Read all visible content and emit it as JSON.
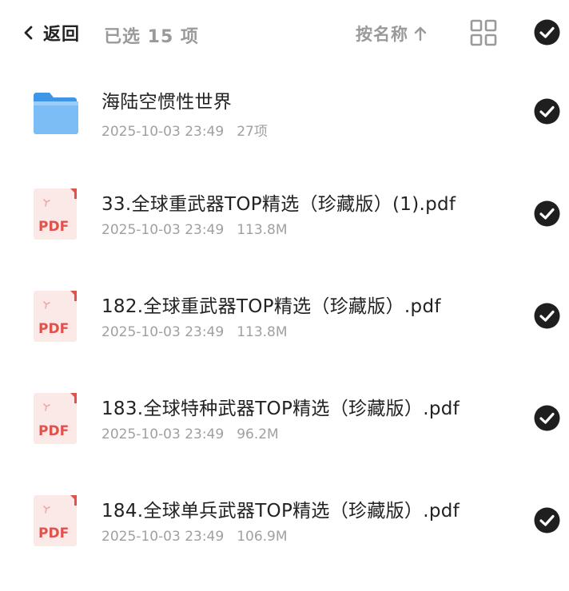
{
  "header": {
    "back_label": "返回",
    "selection_text": "已选 15 项",
    "sort_label": "按名称"
  },
  "icons": {
    "back": "chevron-left-icon",
    "sort_direction": "arrow-up-icon",
    "view_toggle": "grid-view-icon",
    "select_all": "check-circle-icon",
    "folder": "folder-icon",
    "pdf": "pdf-file-icon"
  },
  "colors": {
    "folder_blue": "#5aa9ef",
    "pdf_red": "#e0524b",
    "check_fill": "#1f1f1f",
    "muted_text": "#9a9a9a"
  },
  "files": [
    {
      "name": "海陆空惯性世界",
      "date": "2025-10-03 23:49",
      "size": "27项",
      "type": "folder",
      "selected": true
    },
    {
      "name": "33.全球重武器TOP精选（珍藏版）(1).pdf",
      "date": "2025-10-03 23:49",
      "size": "113.8M",
      "type": "pdf",
      "selected": true
    },
    {
      "name": "182.全球重武器TOP精选（珍藏版）.pdf",
      "date": "2025-10-03 23:49",
      "size": "113.8M",
      "type": "pdf",
      "selected": true
    },
    {
      "name": "183.全球特种武器TOP精选（珍藏版）.pdf",
      "date": "2025-10-03 23:49",
      "size": "96.2M",
      "type": "pdf",
      "selected": true
    },
    {
      "name": "184.全球单兵武器TOP精选（珍藏版）.pdf",
      "date": "2025-10-03 23:49",
      "size": "106.9M",
      "type": "pdf",
      "selected": true
    }
  ],
  "pdf_badge_text": "PDF"
}
